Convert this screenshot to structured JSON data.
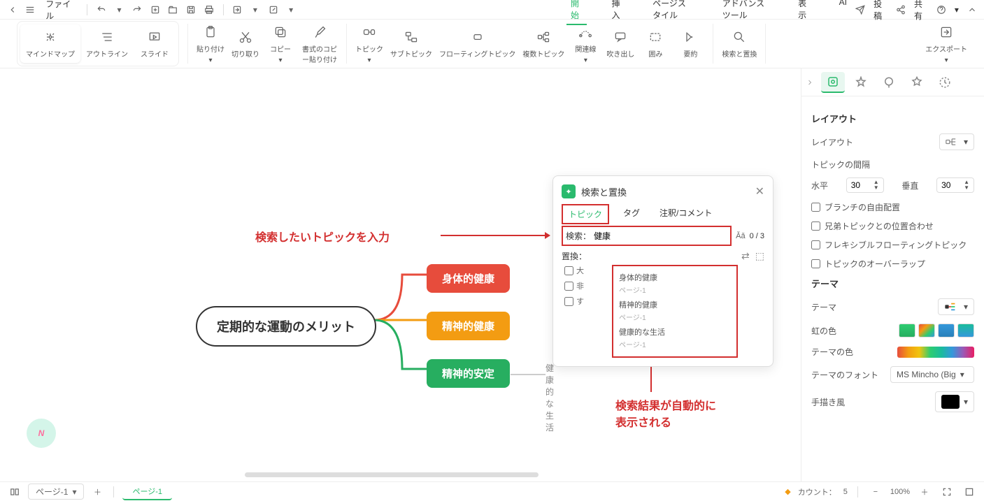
{
  "menubar": {
    "file": "ファイル",
    "tabs": [
      "開始",
      "挿入",
      "ページスタイル",
      "アドバンスツール",
      "表示",
      "AI"
    ],
    "active_tab": 0,
    "post": "投稿",
    "share": "共有"
  },
  "toolbar": {
    "views": {
      "mindmap": "マインドマップ",
      "outline": "アウトライン",
      "slide": "スライド"
    },
    "paste": "貼り付け",
    "cut": "切り取り",
    "copy": "コピー",
    "format_paste": "書式のコピー貼り付け",
    "topic": "トピック",
    "subtopic": "サブトピック",
    "floating": "フローティングトピック",
    "multiple": "複数トピック",
    "relation": "関連線",
    "callout": "吹き出し",
    "boundary": "囲み",
    "summary": "要約",
    "search_replace": "検索と置換",
    "export": "エクスポート"
  },
  "mindmap": {
    "root": "定期的な運動のメリット",
    "child1": "身体的健康",
    "child2": "精神的健康",
    "child3": "精神的安定",
    "grandchild": "健康的な生活"
  },
  "annotations": {
    "a1": "検索したいトピックを入力",
    "a2_l1": "検索結果が自動的に",
    "a2_l2": "表示される"
  },
  "dialog": {
    "title": "検索と置換",
    "tab_topic": "トピック",
    "tab_tag": "タグ",
    "tab_note": "注釈/コメント",
    "search_label": "検索：",
    "search_value": "健康",
    "replace_label": "置換：",
    "count": "0 / 3",
    "chk_case": "大",
    "chk_hide": "非",
    "chk_all": "す",
    "results": [
      {
        "t": "身体的健康",
        "p": "ページ-1"
      },
      {
        "t": "精神的健康",
        "p": "ページ-1"
      },
      {
        "t": "健康的な生活",
        "p": "ページ-1"
      }
    ]
  },
  "rightpanel": {
    "layout_title": "レイアウト",
    "layout_label": "レイアウト",
    "topic_spacing": "トピックの間隔",
    "h_label": "水平",
    "h_val": "30",
    "v_label": "垂直",
    "v_val": "30",
    "chk_free": "ブランチの自由配置",
    "chk_align": "兄弟トピックとの位置合わせ",
    "chk_flex": "フレキシブルフローティングトピック",
    "chk_overlap": "トピックのオーバーラップ",
    "theme_title": "テーマ",
    "theme_label": "テーマ",
    "rainbow_label": "虹の色",
    "theme_color": "テーマの色",
    "theme_font": "テーマのフォント",
    "theme_font_val": "MS Mincho (Big",
    "hand_label": "手描き風"
  },
  "bottombar": {
    "page_select": "ページ-1",
    "page_tab": "ページ-1",
    "count_label": "カウント：",
    "count_val": "5",
    "zoom": "100%"
  }
}
